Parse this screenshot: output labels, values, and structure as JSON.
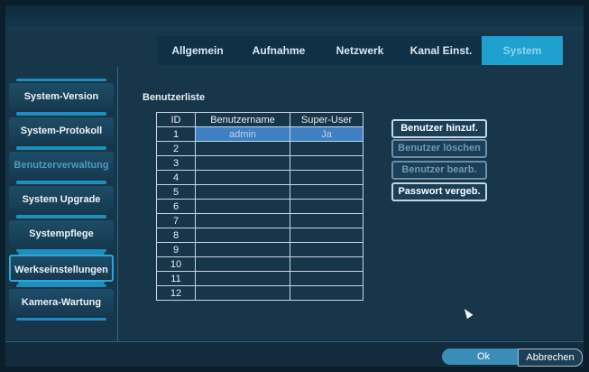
{
  "tabs": [
    {
      "label": "Allgemein"
    },
    {
      "label": "Aufnahme"
    },
    {
      "label": "Netzwerk"
    },
    {
      "label": "Kanal Einst."
    },
    {
      "label": "System"
    }
  ],
  "sidebar": {
    "items": [
      {
        "label": "System-Version"
      },
      {
        "label": "System-Protokoll"
      },
      {
        "label": "Benutzerverwaltung"
      },
      {
        "label": "System Upgrade"
      },
      {
        "label": "Systempflege"
      },
      {
        "label": "Werkseinstellungen"
      },
      {
        "label": "Kamera-Wartung"
      }
    ]
  },
  "user_list": {
    "title": "Benutzerliste",
    "columns": [
      "ID",
      "Benutzername",
      "Super-User"
    ],
    "rows": [
      {
        "id": "1",
        "name": "admin",
        "super": "Ja"
      },
      {
        "id": "2",
        "name": "",
        "super": ""
      },
      {
        "id": "3",
        "name": "",
        "super": ""
      },
      {
        "id": "4",
        "name": "",
        "super": ""
      },
      {
        "id": "5",
        "name": "",
        "super": ""
      },
      {
        "id": "6",
        "name": "",
        "super": ""
      },
      {
        "id": "7",
        "name": "",
        "super": ""
      },
      {
        "id": "8",
        "name": "",
        "super": ""
      },
      {
        "id": "9",
        "name": "",
        "super": ""
      },
      {
        "id": "10",
        "name": "",
        "super": ""
      },
      {
        "id": "11",
        "name": "",
        "super": ""
      },
      {
        "id": "12",
        "name": "",
        "super": ""
      }
    ]
  },
  "actions": {
    "add": "Benutzer hinzuf.",
    "delete": "Benutzer löschen",
    "edit": "Benutzer bearb.",
    "password": "Passwort vergeb."
  },
  "footer": {
    "ok": "Ok",
    "cancel": "Abbrechen"
  },
  "colors": {
    "accent": "#1fa1cf",
    "background": "#17364a",
    "selection": "#3f7fc4"
  }
}
